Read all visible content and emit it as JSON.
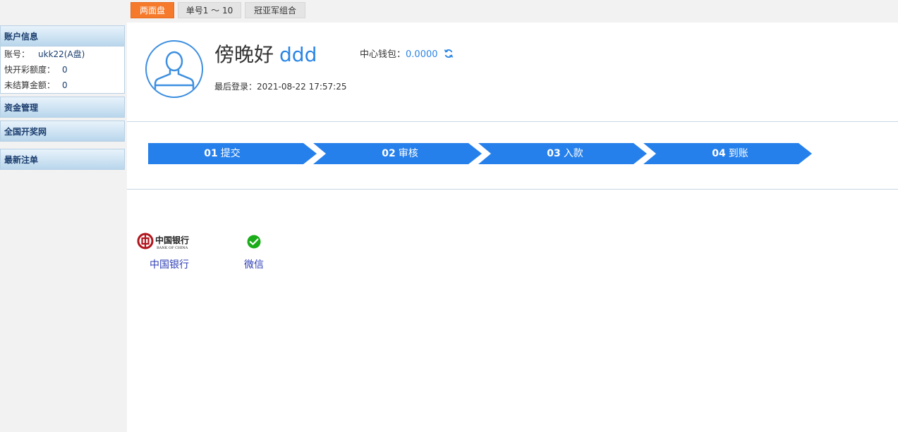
{
  "top_tabs": [
    {
      "label": "两面盘",
      "active": true
    },
    {
      "label": "单号1 ～ 10",
      "active": false
    },
    {
      "label": "冠亚军组合",
      "active": false
    }
  ],
  "sidebar": {
    "account": {
      "title": "账户信息",
      "rows": [
        {
          "label": "账号：",
          "value": "ukk22(A盘)"
        },
        {
          "label": "快开彩额度：",
          "value": "0"
        },
        {
          "label": "未结算金额：",
          "value": "0"
        }
      ]
    },
    "funds_title": "资金管理",
    "lottery_title": "全国开奖网",
    "bets_title": "最新注单"
  },
  "profile": {
    "greeting": "傍晚好",
    "username": "ddd",
    "last_login_label": "最后登录：",
    "last_login_time": "2021-08-22 17:57:25",
    "wallet_label": "中心钱包：",
    "wallet_amount": "0.0000"
  },
  "steps": [
    {
      "num": "01",
      "label": "提交"
    },
    {
      "num": "02",
      "label": "审核"
    },
    {
      "num": "03",
      "label": "入款"
    },
    {
      "num": "04",
      "label": "到账"
    }
  ],
  "payment_methods": [
    {
      "name": "中国银行",
      "icon": "bank-of-china-logo",
      "logo_text": "中国银行",
      "logo_sub": "BANK OF CHINA"
    },
    {
      "name": "微信",
      "icon": "wechat-icon"
    }
  ],
  "colors": {
    "accent_blue": "#2b86e5",
    "step_blue": "#2680eb",
    "tab_active": "#f57a2c",
    "boc_red": "#b0141c",
    "wechat_green": "#1aad19"
  }
}
